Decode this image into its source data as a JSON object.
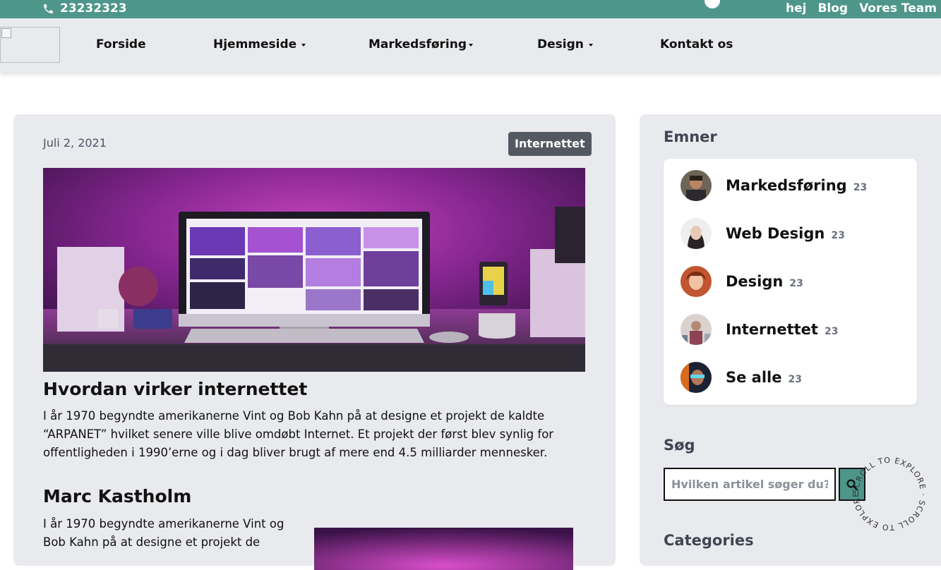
{
  "topbar": {
    "phone": "23232323",
    "links": [
      "hej",
      "Blog",
      "Vores Team"
    ]
  },
  "nav": {
    "items": [
      {
        "label": "Forside"
      },
      {
        "label": "Hjemmeside"
      },
      {
        "label": "Markedsføring"
      },
      {
        "label": "Design"
      },
      {
        "label": "Kontakt os"
      }
    ]
  },
  "post": {
    "date": "Juli 2, 2021",
    "tag": "Internettet",
    "title": "Hvordan virker internettet",
    "text": "I år 1970 begyndte amerikanerne Vint og Bob Kahn på at designe et projekt de kaldte “ARPANET” hvilket senere ville blive omdøbt Internet. Et projekt der først blev synlig for offentligheden i 1990’erne og i dag bliver brugt af mere end 4.5 milliarder mennesker.",
    "author": "Marc Kastholm",
    "author_text": "I år 1970 begyndte amerikanerne Vint og Bob Kahn på at designe et projekt de"
  },
  "sidebar": {
    "topics_title": "Emner",
    "topics": [
      {
        "name": "Markedsføring",
        "count": "23"
      },
      {
        "name": "Web Design",
        "count": "23"
      },
      {
        "name": "Design",
        "count": "23"
      },
      {
        "name": "Internettet",
        "count": "23"
      },
      {
        "name": "Se alle",
        "count": "23"
      }
    ],
    "search_title": "Søg",
    "search_placeholder": "Hvilken artikel søger du?",
    "categories_title": "Categories"
  },
  "scroll_badge": "SCROLL TO EXPLORE · SCROLL TO EXPLORE · ",
  "colors": {
    "accent": "#4e968a",
    "card": "#e9eaed",
    "tag": "#545861"
  }
}
